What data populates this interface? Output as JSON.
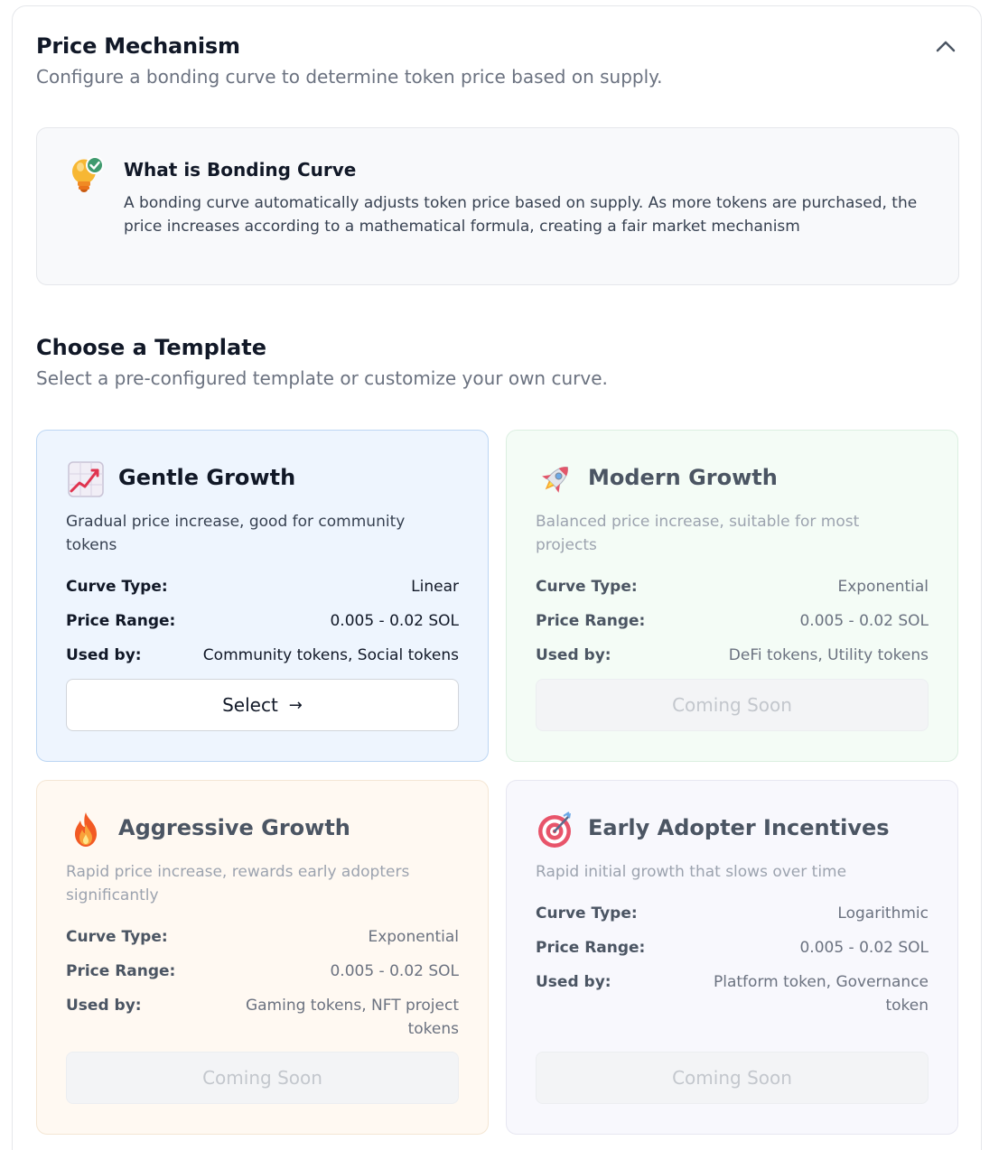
{
  "header": {
    "title": "Price Mechanism",
    "subtitle": "Configure a bonding curve to determine token price based on supply."
  },
  "info": {
    "title": "What is Bonding Curve",
    "text": "A bonding curve automatically adjusts token price based on supply. As more tokens are purchased, the price increases according to a mathematical formula, creating a fair market mechanism"
  },
  "templates": {
    "title": "Choose a Template",
    "subtitle": "Select a pre-configured template or customize your own curve.",
    "labels": {
      "curve_type": "Curve Type:",
      "price_range": "Price Range:",
      "used_by": "Used by:"
    },
    "cards": [
      {
        "icon": "chart-increasing-icon",
        "name": "Gentle Growth",
        "description": "Gradual price increase, good for community tokens",
        "curve_type": "Linear",
        "price_range": "0.005 - 0.02 SOL",
        "used_by": "Community tokens, Social tokens",
        "button": "Select",
        "button_icon": "arrow-right-icon"
      },
      {
        "icon": "rocket-icon",
        "name": "Modern Growth",
        "description": "Balanced price increase, suitable for most projects",
        "curve_type": "Exponential",
        "price_range": "0.005 - 0.02 SOL",
        "used_by": "DeFi tokens, Utility tokens",
        "button": "Coming Soon"
      },
      {
        "icon": "fire-icon",
        "name": "Aggressive Growth",
        "description": "Rapid price increase, rewards early adopters significantly",
        "curve_type": "Exponential",
        "price_range": "0.005 - 0.02 SOL",
        "used_by": "Gaming tokens, NFT project tokens",
        "button": "Coming Soon"
      },
      {
        "icon": "target-icon",
        "name": "Early Adopter Incentives",
        "description": "Rapid initial growth that slows over time",
        "curve_type": "Logarithmic",
        "price_range": "0.005 - 0.02 SOL",
        "used_by": "Platform token, Governance token",
        "button": "Coming Soon"
      }
    ]
  }
}
